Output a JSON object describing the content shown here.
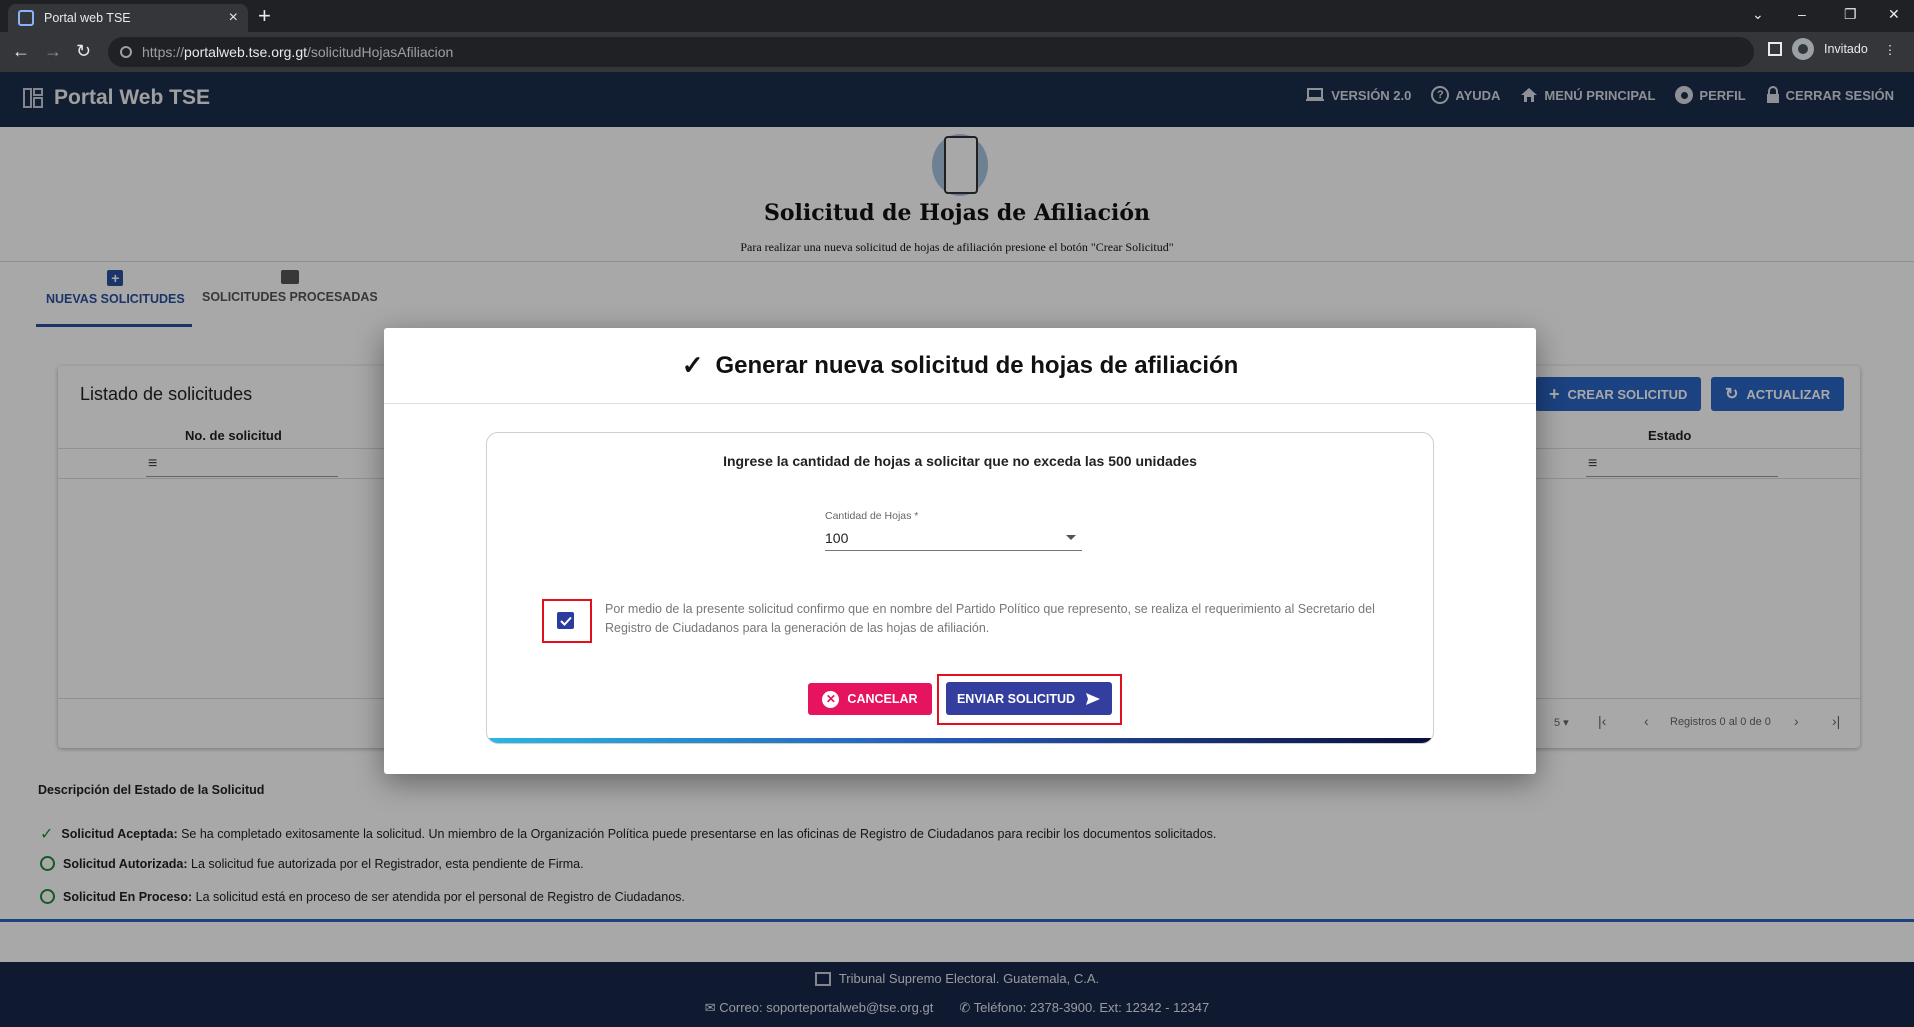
{
  "browser": {
    "tab_title": "Portal web TSE",
    "url_prefix": "https://",
    "url_domain": "portalweb.tse.org.gt",
    "url_path": "/solicitudHojasAfiliacion",
    "profile_label": "Invitado"
  },
  "header": {
    "brand": "Portal Web TSE",
    "nav": [
      {
        "label": "VERSIÓN 2.0",
        "icon": "laptop-icon"
      },
      {
        "label": "AYUDA",
        "icon": "help-icon"
      },
      {
        "label": "MENÚ PRINCIPAL",
        "icon": "home-icon"
      },
      {
        "label": "PERFIL",
        "icon": "account-icon"
      },
      {
        "label": "CERRAR SESIÓN",
        "icon": "lock-icon"
      }
    ]
  },
  "page": {
    "title": "Solicitud de Hojas de Afiliación",
    "subtitle": "Para realizar una nueva solicitud de hojas de afiliación presione el botón \"Crear Solicitud\"",
    "tabs": [
      {
        "label": "NUEVAS SOLICITUDES",
        "active": true
      },
      {
        "label": "SOLICITUDES PROCESADAS",
        "active": false
      }
    ],
    "card_title": "Listado de solicitudes",
    "columns": [
      "No. de solicitud",
      "Estado"
    ],
    "create_button": "CREAR SOLICITUD",
    "refresh_button": "ACTUALIZAR",
    "page_size": "5",
    "records_text": "Registros 0 al 0 de 0",
    "legend_title": "Descripción del Estado de la Solicitud",
    "legend": [
      {
        "term": "Solicitud Aceptada:",
        "desc": " Se ha completado exitosamente la solicitud. Un miembro de la Organización Política puede presentarse en las oficinas de Registro de Ciudadanos para recibir los documentos solicitados."
      },
      {
        "term": "Solicitud Autorizada:",
        "desc": " La solicitud fue autorizada por el Registrador, esta pendiente de Firma."
      },
      {
        "term": "Solicitud En Proceso:",
        "desc": " La solicitud está en proceso de ser atendida por el personal de Registro de Ciudadanos."
      }
    ]
  },
  "footer": {
    "line1": "Tribunal Supremo Electoral. Guatemala, C.A.",
    "email": "Correo: soporteportalweb@tse.org.gt",
    "phone": "Teléfono: 2378-3900. Ext: 12342 - 12347"
  },
  "modal": {
    "title": "Generar nueva solicitud de hojas de afiliación",
    "instruction": "Ingrese la cantidad de hojas a solicitar que no exceda las 500 unidades",
    "field_label": "Cantidad de Hojas *",
    "field_value": "100",
    "checkbox_checked": true,
    "checkbox_text": "Por medio de la presente solicitud confirmo que en nombre del Partido Político que represento, se realiza el requerimiento al Secretario del Registro de Ciudadanos para la generación de las hojas de afiliación.",
    "cancel_label": "CANCELAR",
    "send_label": "ENVIAR SOLICITUD"
  },
  "colors": {
    "appbar": "#1b2e4d",
    "primary": "#2a65c4",
    "send": "#333e9f",
    "cancel": "#e6145e",
    "highlight": "#e2101a"
  }
}
